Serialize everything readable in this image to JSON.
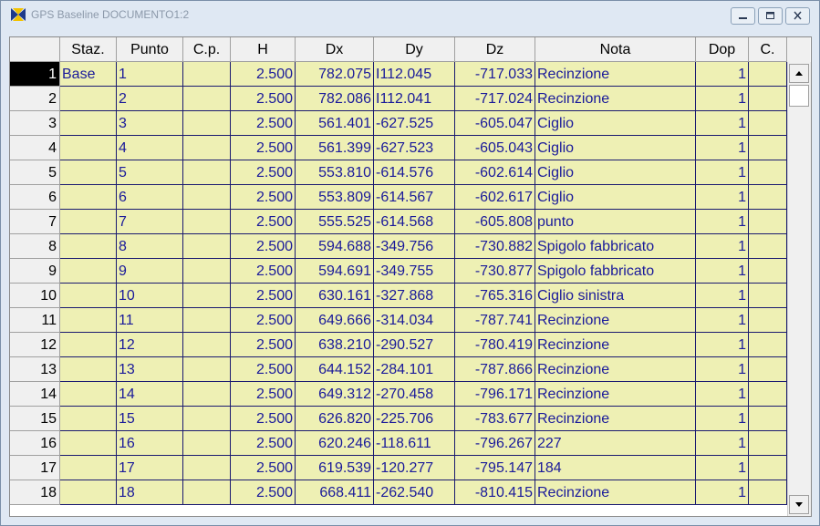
{
  "window": {
    "title": "GPS Baseline DOCUMENTO1:2",
    "controls": [
      "minimize-icon",
      "maximize-icon",
      "close-icon"
    ]
  },
  "colors": {
    "cell_bg": "#eef0b4",
    "cell_text": "#1a1a9a",
    "grid_line": "#1a1a70",
    "header_bg": "#f0f0f0"
  },
  "table": {
    "columns": [
      "Staz.",
      "Punto",
      "C.p.",
      "H",
      "Dx",
      "Dy",
      "Dz",
      "Nota",
      "Dop",
      "C."
    ],
    "selected_row": 1,
    "rows": [
      {
        "num": "1",
        "staz": "Base",
        "punto": "1",
        "cp": "",
        "h": "2.500",
        "dx": "782.075",
        "dy": "I112.045",
        "dz": "-717.033",
        "nota": "Recinzione",
        "dop": "1",
        "c": ""
      },
      {
        "num": "2",
        "staz": "",
        "punto": "2",
        "cp": "",
        "h": "2.500",
        "dx": "782.086",
        "dy": "I112.041",
        "dz": "-717.024",
        "nota": "Recinzione",
        "dop": "1",
        "c": ""
      },
      {
        "num": "3",
        "staz": "",
        "punto": "3",
        "cp": "",
        "h": "2.500",
        "dx": "561.401",
        "dy": "-627.525",
        "dz": "-605.047",
        "nota": "Ciglio",
        "dop": "1",
        "c": ""
      },
      {
        "num": "4",
        "staz": "",
        "punto": "4",
        "cp": "",
        "h": "2.500",
        "dx": "561.399",
        "dy": "-627.523",
        "dz": "-605.043",
        "nota": "Ciglio",
        "dop": "1",
        "c": ""
      },
      {
        "num": "5",
        "staz": "",
        "punto": "5",
        "cp": "",
        "h": "2.500",
        "dx": "553.810",
        "dy": "-614.576",
        "dz": "-602.614",
        "nota": "Ciglio",
        "dop": "1",
        "c": ""
      },
      {
        "num": "6",
        "staz": "",
        "punto": "6",
        "cp": "",
        "h": "2.500",
        "dx": "553.809",
        "dy": "-614.567",
        "dz": "-602.617",
        "nota": "Ciglio",
        "dop": "1",
        "c": ""
      },
      {
        "num": "7",
        "staz": "",
        "punto": "7",
        "cp": "",
        "h": "2.500",
        "dx": "555.525",
        "dy": "-614.568",
        "dz": "-605.808",
        "nota": "punto",
        "dop": "1",
        "c": ""
      },
      {
        "num": "8",
        "staz": "",
        "punto": "8",
        "cp": "",
        "h": "2.500",
        "dx": "594.688",
        "dy": "-349.756",
        "dz": "-730.882",
        "nota": "Spigolo fabbricato",
        "dop": "1",
        "c": ""
      },
      {
        "num": "9",
        "staz": "",
        "punto": "9",
        "cp": "",
        "h": "2.500",
        "dx": "594.691",
        "dy": "-349.755",
        "dz": "-730.877",
        "nota": "Spigolo fabbricato",
        "dop": "1",
        "c": ""
      },
      {
        "num": "10",
        "staz": "",
        "punto": "10",
        "cp": "",
        "h": "2.500",
        "dx": "630.161",
        "dy": "-327.868",
        "dz": "-765.316",
        "nota": "Ciglio sinistra",
        "dop": "1",
        "c": ""
      },
      {
        "num": "11",
        "staz": "",
        "punto": "11",
        "cp": "",
        "h": "2.500",
        "dx": "649.666",
        "dy": "-314.034",
        "dz": "-787.741",
        "nota": "Recinzione",
        "dop": "1",
        "c": ""
      },
      {
        "num": "12",
        "staz": "",
        "punto": "12",
        "cp": "",
        "h": "2.500",
        "dx": "638.210",
        "dy": "-290.527",
        "dz": "-780.419",
        "nota": "Recinzione",
        "dop": "1",
        "c": ""
      },
      {
        "num": "13",
        "staz": "",
        "punto": "13",
        "cp": "",
        "h": "2.500",
        "dx": "644.152",
        "dy": "-284.101",
        "dz": "-787.866",
        "nota": "Recinzione",
        "dop": "1",
        "c": ""
      },
      {
        "num": "14",
        "staz": "",
        "punto": "14",
        "cp": "",
        "h": "2.500",
        "dx": "649.312",
        "dy": "-270.458",
        "dz": "-796.171",
        "nota": "Recinzione",
        "dop": "1",
        "c": ""
      },
      {
        "num": "15",
        "staz": "",
        "punto": "15",
        "cp": "",
        "h": "2.500",
        "dx": "626.820",
        "dy": "-225.706",
        "dz": "-783.677",
        "nota": "Recinzione",
        "dop": "1",
        "c": ""
      },
      {
        "num": "16",
        "staz": "",
        "punto": "16",
        "cp": "",
        "h": "2.500",
        "dx": "620.246",
        "dy": "-118.611",
        "dz": "-796.267",
        "nota": "227",
        "dop": "1",
        "c": ""
      },
      {
        "num": "17",
        "staz": "",
        "punto": "17",
        "cp": "",
        "h": "2.500",
        "dx": "619.539",
        "dy": "-120.277",
        "dz": "-795.147",
        "nota": "184",
        "dop": "1",
        "c": ""
      },
      {
        "num": "18",
        "staz": "",
        "punto": "18",
        "cp": "",
        "h": "2.500",
        "dx": "668.411",
        "dy": "-262.540",
        "dz": "-810.415",
        "nota": "Recinzione",
        "dop": "1",
        "c": ""
      }
    ]
  },
  "scrollbar": {
    "up_icon": "arrow-up-icon",
    "down_icon": "arrow-down-icon"
  }
}
